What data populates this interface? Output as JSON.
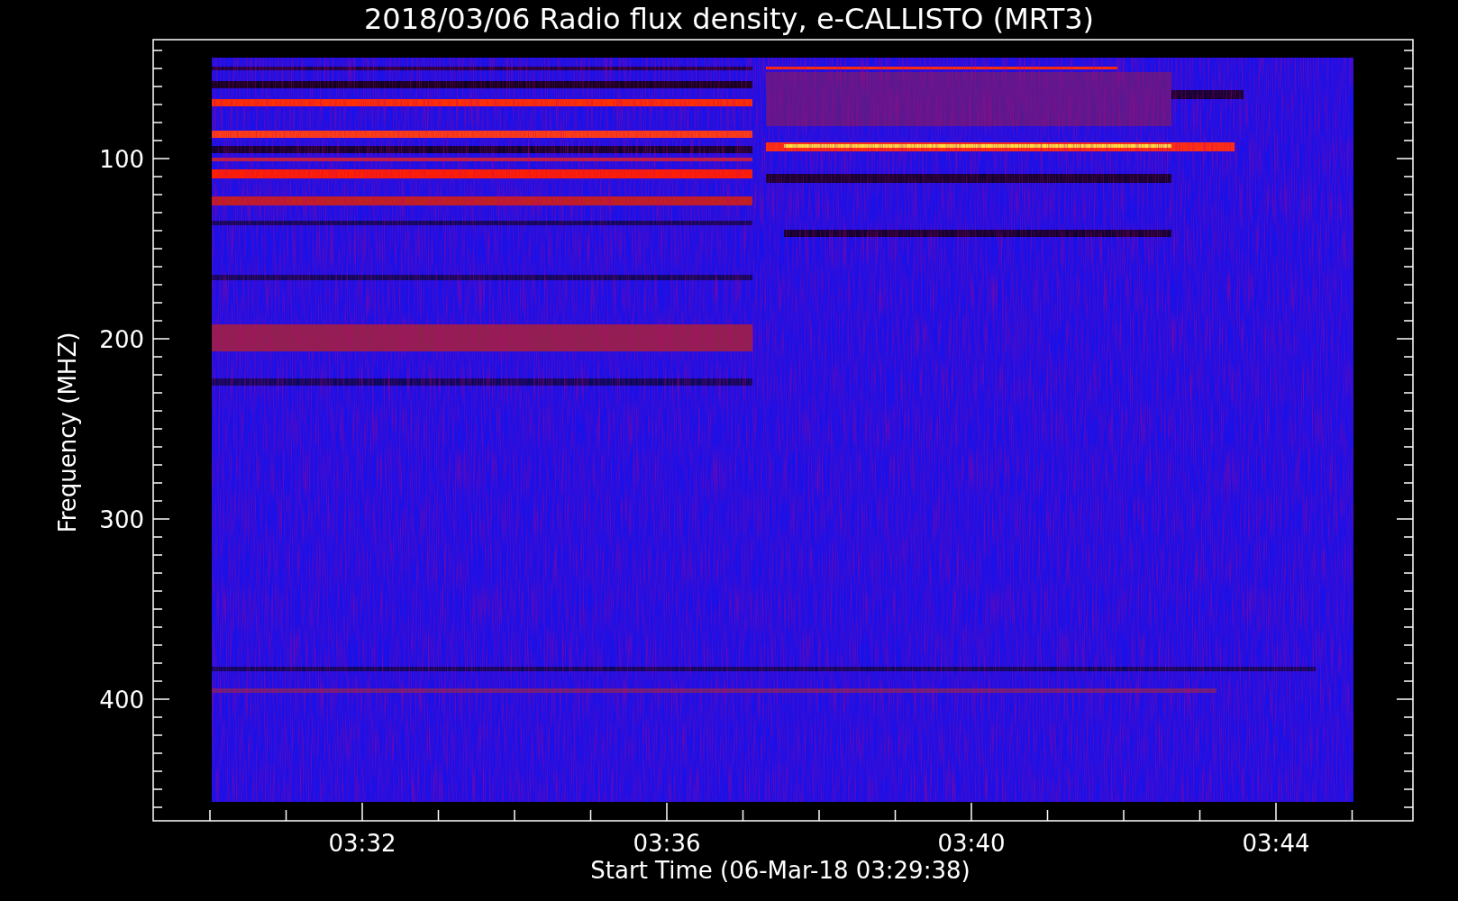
{
  "title": "2018/03/06  Radio flux density, e-CALLISTO (MRT3)",
  "y_axis": {
    "label": "Frequency (MHZ)",
    "ticks": [
      "100",
      "200",
      "300",
      "400"
    ]
  },
  "x_axis": {
    "label": "Start Time (06-Mar-18 03:29:38)",
    "ticks": [
      "03:32",
      "03:36",
      "03:40",
      "03:44"
    ]
  }
}
